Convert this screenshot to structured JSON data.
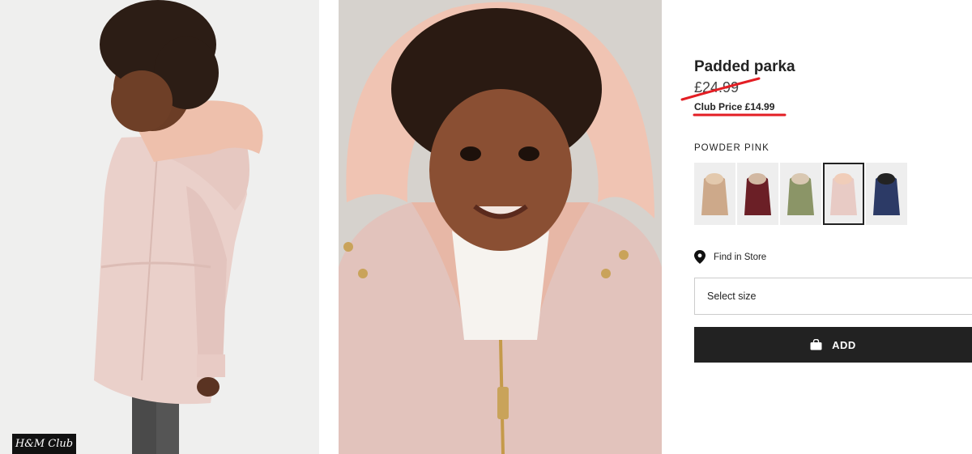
{
  "product": {
    "title": "Padded parka",
    "old_price": "£24.99",
    "club_price": "Club Price £14.99"
  },
  "color": {
    "selected_name": "POWDER PINK",
    "swatches": [
      {
        "name": "beige",
        "color": "#cda98a"
      },
      {
        "name": "burgundy",
        "color": "#6b1f26"
      },
      {
        "name": "khaki",
        "color": "#8b9567"
      },
      {
        "name": "powder pink",
        "color": "#e8cbc5",
        "selected": true
      },
      {
        "name": "navy",
        "color": "#2c3a66"
      }
    ]
  },
  "store": {
    "find_label": "Find in Store",
    "icon": "location-pin-icon"
  },
  "size": {
    "placeholder": "Select size"
  },
  "cart": {
    "add_label": "ADD",
    "icon": "shopping-bag-icon"
  },
  "badge": {
    "label": "H&M Club"
  },
  "colors": {
    "button_bg": "#222222",
    "annotation_red": "#e31e24",
    "parka_pink": "#e8cbc5"
  }
}
